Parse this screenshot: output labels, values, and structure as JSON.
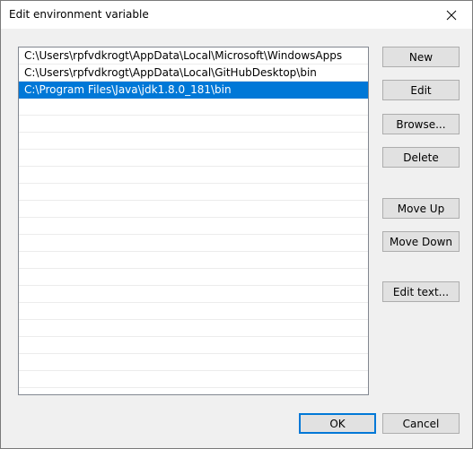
{
  "window": {
    "title": "Edit environment variable",
    "close_icon": "close-icon"
  },
  "list": {
    "entries": [
      "C:\\Users\\rpfvdkrogt\\AppData\\Local\\Microsoft\\WindowsApps",
      "C:\\Users\\rpfvdkrogt\\AppData\\Local\\GitHubDesktop\\bin",
      "C:\\Program Files\\Java\\jdk1.8.0_181\\bin"
    ],
    "selected_index": 2,
    "selection_color": "#0078d7"
  },
  "buttons": {
    "new": "New",
    "edit": "Edit",
    "browse": "Browse...",
    "delete": "Delete",
    "move_up": "Move Up",
    "move_down": "Move Down",
    "edit_text": "Edit text...",
    "ok": "OK",
    "cancel": "Cancel"
  }
}
